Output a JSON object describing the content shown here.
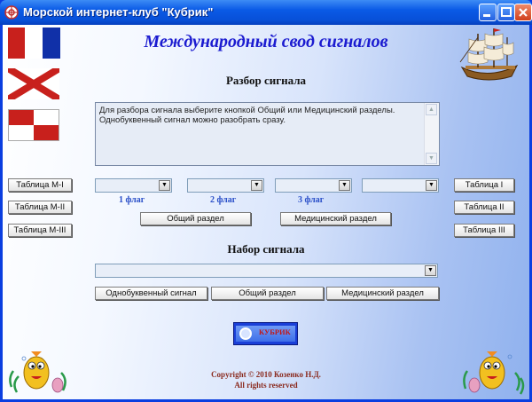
{
  "window": {
    "title": "Морской интернет-клуб \"Кубрик\""
  },
  "header": {
    "title": "Международный свод сигналов"
  },
  "decode": {
    "title": "Разбор сигнала",
    "info_line1": "Для разбора сигнала выберите кнопкой Общий или Медицинский разделы.",
    "info_line2": "Однобуквенный сигнал можно разобрать сразу."
  },
  "left_tables": [
    {
      "label": "Таблица M-I"
    },
    {
      "label": "Таблица M-II"
    },
    {
      "label": "Таблица M-III"
    }
  ],
  "right_tables": [
    {
      "label": "Таблица I"
    },
    {
      "label": "Таблица II"
    },
    {
      "label": "Таблица III"
    }
  ],
  "flag_selects": [
    {
      "value": "",
      "label": ""
    },
    {
      "value": "",
      "label": "1 флаг"
    },
    {
      "value": "",
      "label": "2 флаг"
    },
    {
      "value": "",
      "label": "3 флаг"
    }
  ],
  "decode_buttons": {
    "general": "Общий раздел",
    "medical": "Медицинский раздел"
  },
  "compose": {
    "title": "Набор сигнала",
    "select_value": "",
    "buttons": {
      "single": "Однобуквенный сигнал",
      "general": "Общий раздел",
      "medical": "Медицинский раздел"
    }
  },
  "logo": {
    "text": "КУБРИК"
  },
  "footer": {
    "copyright": "Copyright © 2010 Козенко Н.Д.",
    "rights": "All rights reserved"
  },
  "colors": {
    "title_accent": "#1b1bd0",
    "flag_label": "#2a4fc8",
    "copyright": "#8a2a1e"
  }
}
